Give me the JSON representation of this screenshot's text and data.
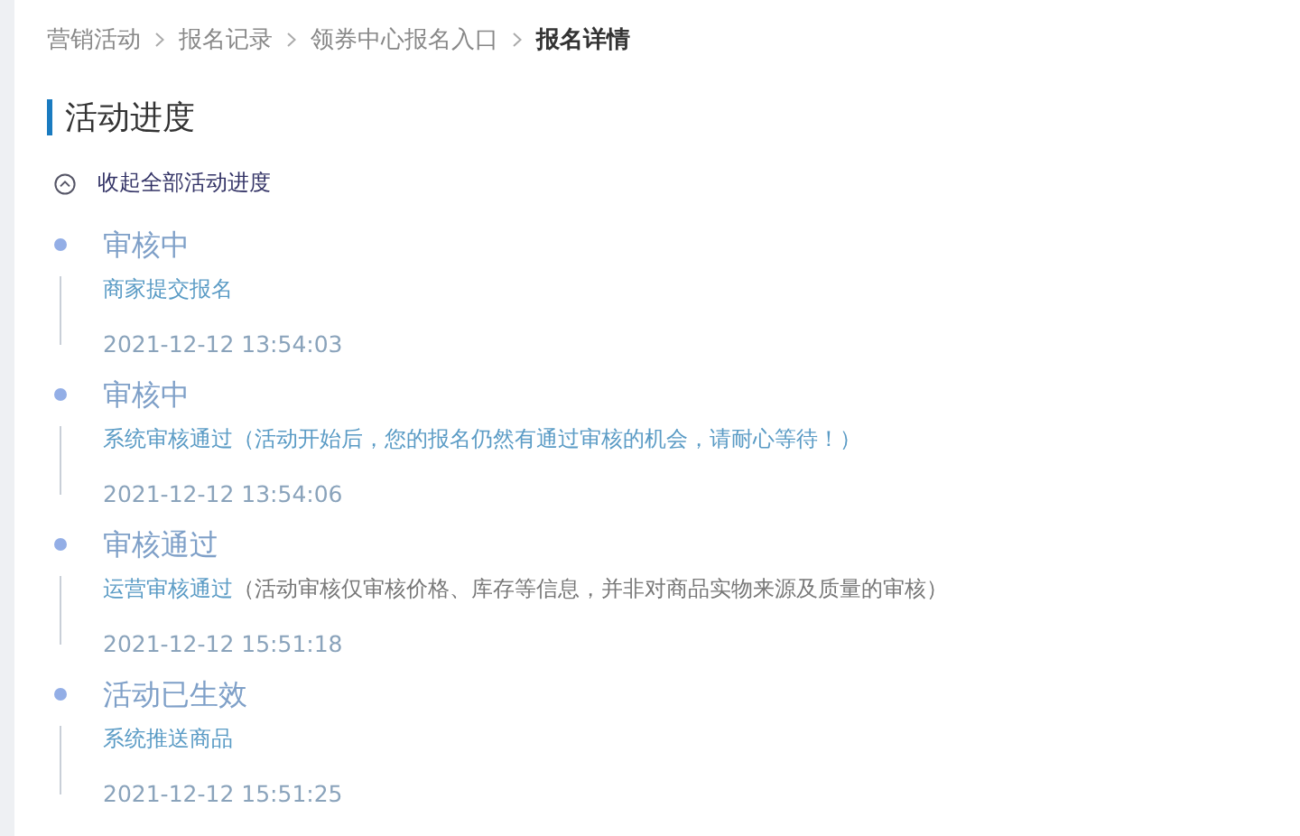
{
  "breadcrumb": [
    {
      "label": "营销活动",
      "current": false
    },
    {
      "label": "报名记录",
      "current": false
    },
    {
      "label": "领券中心报名入口",
      "current": false
    },
    {
      "label": "报名详情",
      "current": true
    }
  ],
  "section_title": "活动进度",
  "collapse_toggle": {
    "label": "收起全部活动进度",
    "expanded": true
  },
  "timeline": [
    {
      "status": "审核中",
      "desc": "商家提交报名",
      "time": "2021-12-12 13:54:03"
    },
    {
      "status": "审核中",
      "desc": "系统审核通过",
      "note": "（活动开始后，您的报名仍然有通过审核的机会，请耐心等待！）",
      "note_muted": false,
      "time": "2021-12-12 13:54:06"
    },
    {
      "status": "审核通过",
      "desc": "运营审核通过",
      "note": "（活动审核仅审核价格、库存等信息，并非对商品实物来源及质量的审核）",
      "note_muted": true,
      "time": "2021-12-12 15:51:18"
    },
    {
      "status": "活动已生效",
      "desc": "系统推送商品",
      "time": "2021-12-12 15:51:25"
    }
  ]
}
